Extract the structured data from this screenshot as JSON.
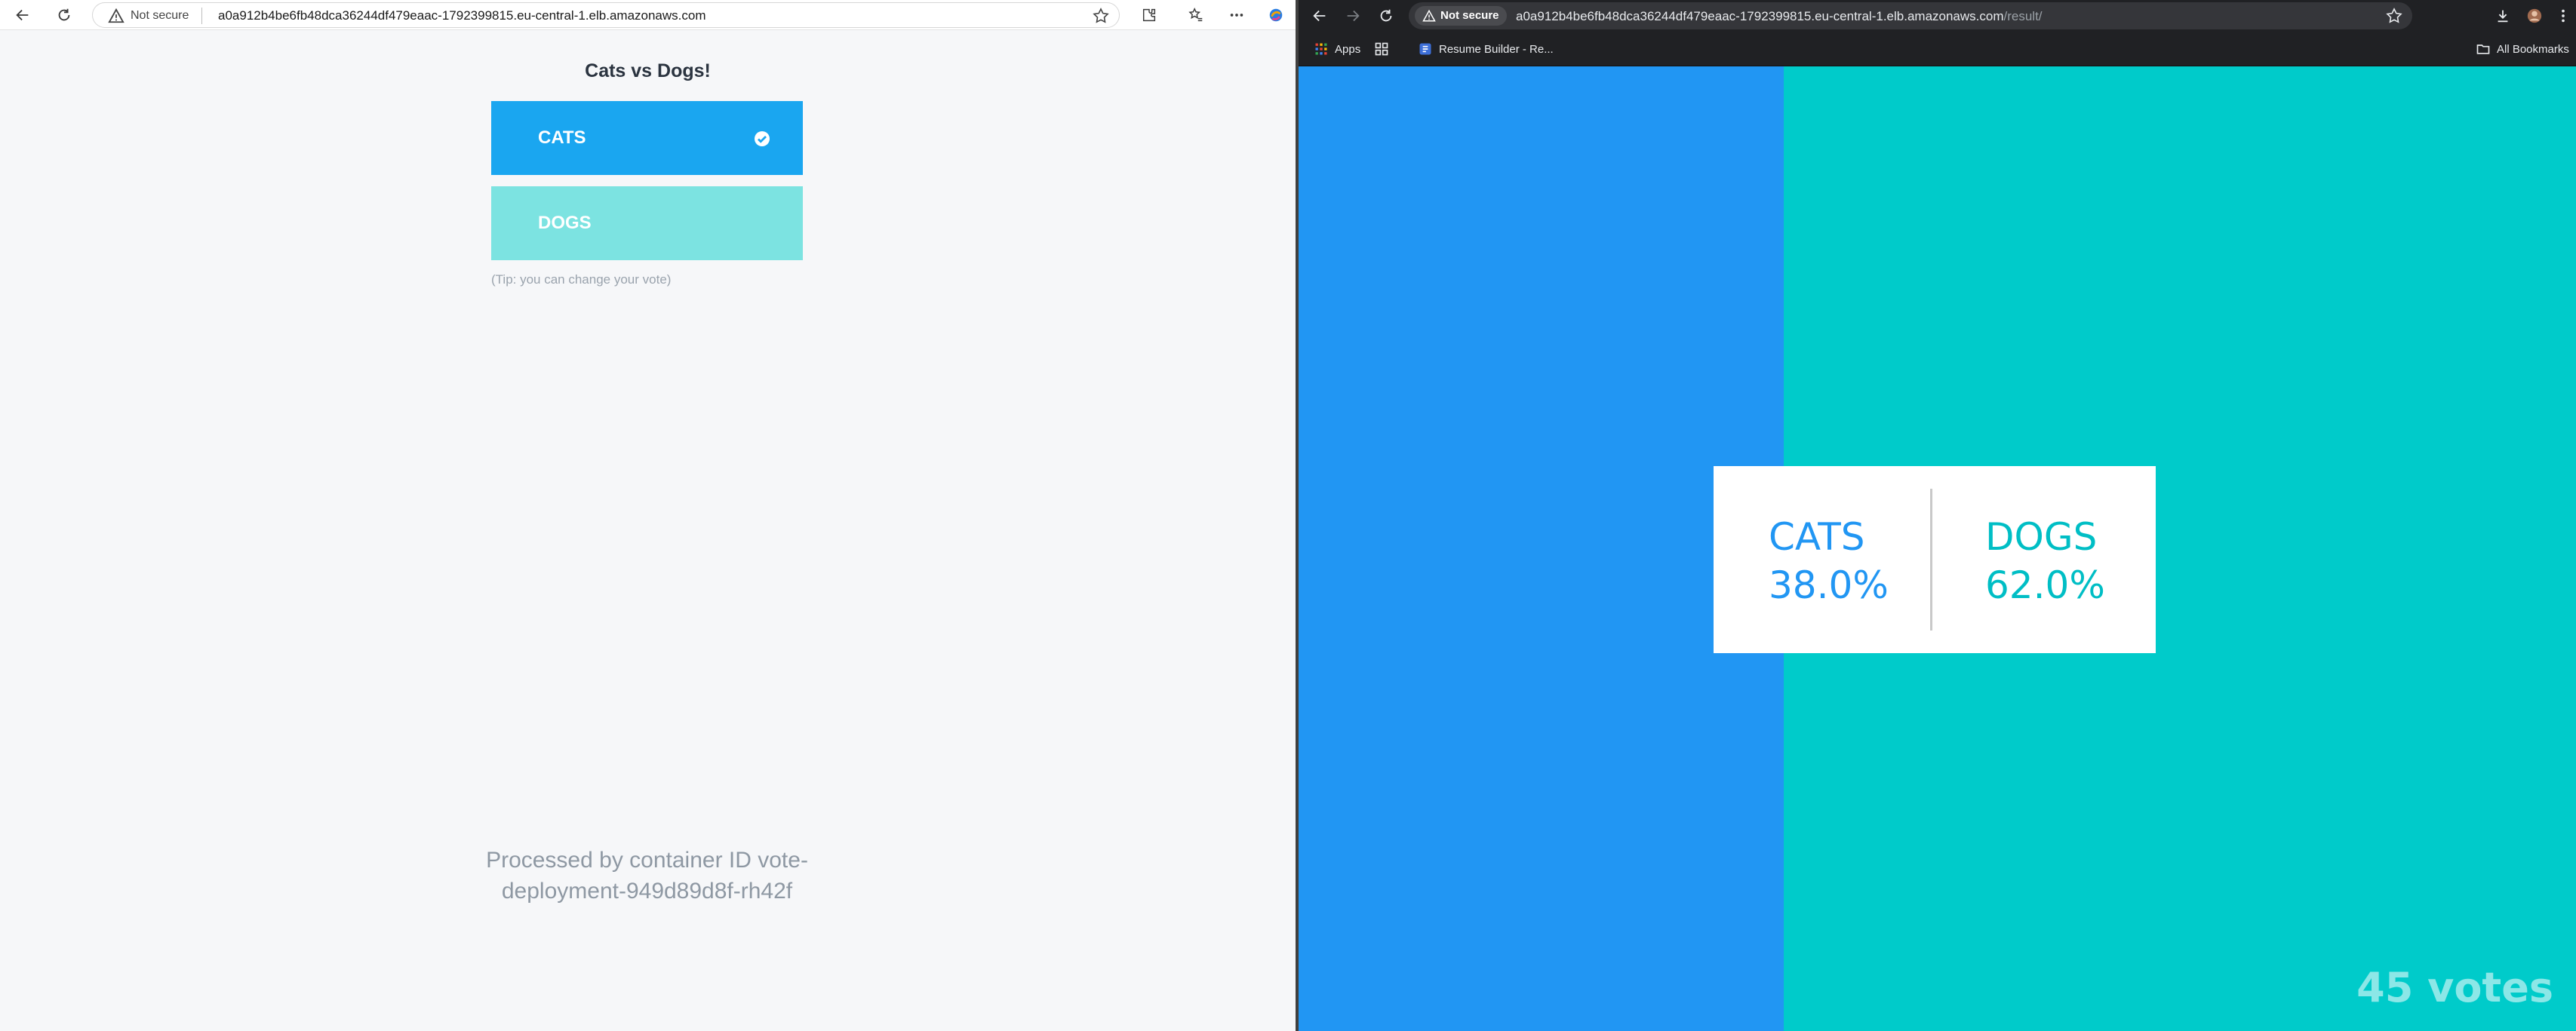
{
  "left_browser": {
    "security_label": "Not secure",
    "url": "a0a912b4be6fb48dca36244df479eaac-1792399815.eu-central-1.elb.amazonaws.com"
  },
  "vote_app": {
    "title": "Cats vs Dogs!",
    "option_a": "CATS",
    "option_b": "DOGS",
    "selected": "CATS",
    "tip": "(Tip: you can change your vote)",
    "container_info": "Processed by container ID vote-deployment-949d89d8f-rh42f"
  },
  "right_browser": {
    "security_label": "Not secure",
    "url_host": "a0a912b4be6fb48dca36244df479eaac-1792399815.eu-central-1.elb.amazonaws.com",
    "url_path": "/result/",
    "bookmarks": {
      "apps": "Apps",
      "resume": "Resume Builder - Re...",
      "all": "All Bookmarks"
    }
  },
  "result_app": {
    "cats_label": "CATS",
    "cats_percent": "38.0%",
    "cats_fraction": 0.38,
    "dogs_label": "DOGS",
    "dogs_percent": "62.0%",
    "votes": "45 votes"
  },
  "colors": {
    "cats_blue": "#2196f3",
    "dogs_teal": "#00cbca",
    "vote_cats_button": "#1aa6f0",
    "vote_dogs_button": "#7ce3e1"
  }
}
